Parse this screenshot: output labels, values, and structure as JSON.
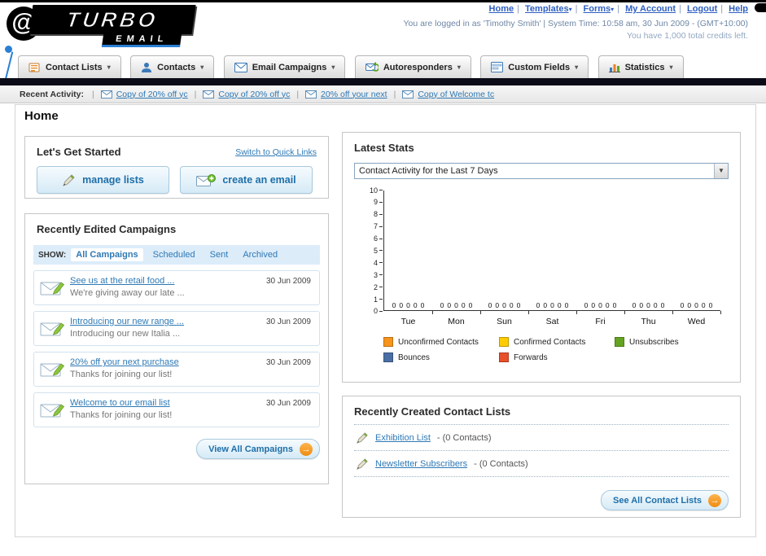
{
  "header": {
    "logo_top": "TURBO",
    "logo_bottom": "EMAIL",
    "logo_swirl": "@",
    "nav_links": [
      "Home",
      "Templates",
      "Forms",
      "My Account",
      "Logout",
      "Help"
    ],
    "login_info": "You are logged in as 'Timothy Smith' | System Time: 10:58 am, 30 Jun 2009 - (GMT+10:00)",
    "credits_info": "You have 1,000 total credits left."
  },
  "nav_tabs": [
    {
      "label": "Contact Lists",
      "icon": "contact-lists-icon"
    },
    {
      "label": "Contacts",
      "icon": "contacts-icon"
    },
    {
      "label": "Email Campaigns",
      "icon": "email-campaigns-icon"
    },
    {
      "label": "Autoresponders",
      "icon": "autoresponders-icon"
    },
    {
      "label": "Custom Fields",
      "icon": "custom-fields-icon"
    },
    {
      "label": "Statistics",
      "icon": "statistics-icon"
    }
  ],
  "recent_activity": {
    "label": "Recent Activity:",
    "items": [
      "Copy of 20% off yc",
      "Copy of 20% off yc",
      "20% off your next",
      "Copy of Welcome tc"
    ]
  },
  "page_title": "Home",
  "get_started": {
    "title": "Let's Get Started",
    "switch_link": "Switch to Quick Links",
    "manage_lists_label": "manage lists",
    "create_email_label": "create an email"
  },
  "campaigns": {
    "title": "Recently Edited Campaigns",
    "show_label": "SHOW:",
    "filters": [
      "All Campaigns",
      "Scheduled",
      "Sent",
      "Archived"
    ],
    "active_filter": "All Campaigns",
    "items": [
      {
        "title": "See us at the retail food ...",
        "subtitle": "We're giving away our late ...",
        "date": "30 Jun 2009"
      },
      {
        "title": "Introducing our new range ...",
        "subtitle": "Introducing our new Italia ...",
        "date": "30 Jun 2009"
      },
      {
        "title": "20% off your next purchase",
        "subtitle": "Thanks for joining our list!",
        "date": "30 Jun 2009"
      },
      {
        "title": "Welcome to our email list",
        "subtitle": "Thanks for joining our list!",
        "date": "30 Jun 2009"
      }
    ],
    "view_all_label": "View All Campaigns"
  },
  "latest_stats": {
    "title": "Latest Stats",
    "dropdown_value": "Contact Activity for the Last 7 Days"
  },
  "chart_data": {
    "type": "bar",
    "title": "Contact Activity for the Last 7 Days",
    "categories": [
      "Tue",
      "Mon",
      "Sun",
      "Sat",
      "Fri",
      "Thu",
      "Wed"
    ],
    "series": [
      {
        "name": "Unconfirmed Contacts",
        "color": "#f7941d",
        "values": [
          0,
          0,
          0,
          0,
          0,
          0,
          0
        ]
      },
      {
        "name": "Confirmed Contacts",
        "color": "#ffcc00",
        "values": [
          0,
          0,
          0,
          0,
          0,
          0,
          0
        ]
      },
      {
        "name": "Unsubscribes",
        "color": "#64a321",
        "values": [
          0,
          0,
          0,
          0,
          0,
          0,
          0
        ]
      },
      {
        "name": "Bounces",
        "color": "#4a6fa5",
        "values": [
          0,
          0,
          0,
          0,
          0,
          0,
          0
        ]
      },
      {
        "name": "Forwards",
        "color": "#e8502a",
        "values": [
          0,
          0,
          0,
          0,
          0,
          0,
          0
        ]
      }
    ],
    "ylim": [
      0,
      10
    ],
    "yticks": [
      0,
      1,
      2,
      3,
      4,
      5,
      6,
      7,
      8,
      9,
      10
    ],
    "grid": false,
    "legend_position": "bottom"
  },
  "contact_lists": {
    "title": "Recently Created Contact Lists",
    "items": [
      {
        "name": "Exhibition List",
        "suffix": "- (0 Contacts)"
      },
      {
        "name": "Newsletter Subscribers",
        "suffix": "- (0 Contacts)"
      }
    ],
    "see_all_label": "See All Contact Lists"
  }
}
